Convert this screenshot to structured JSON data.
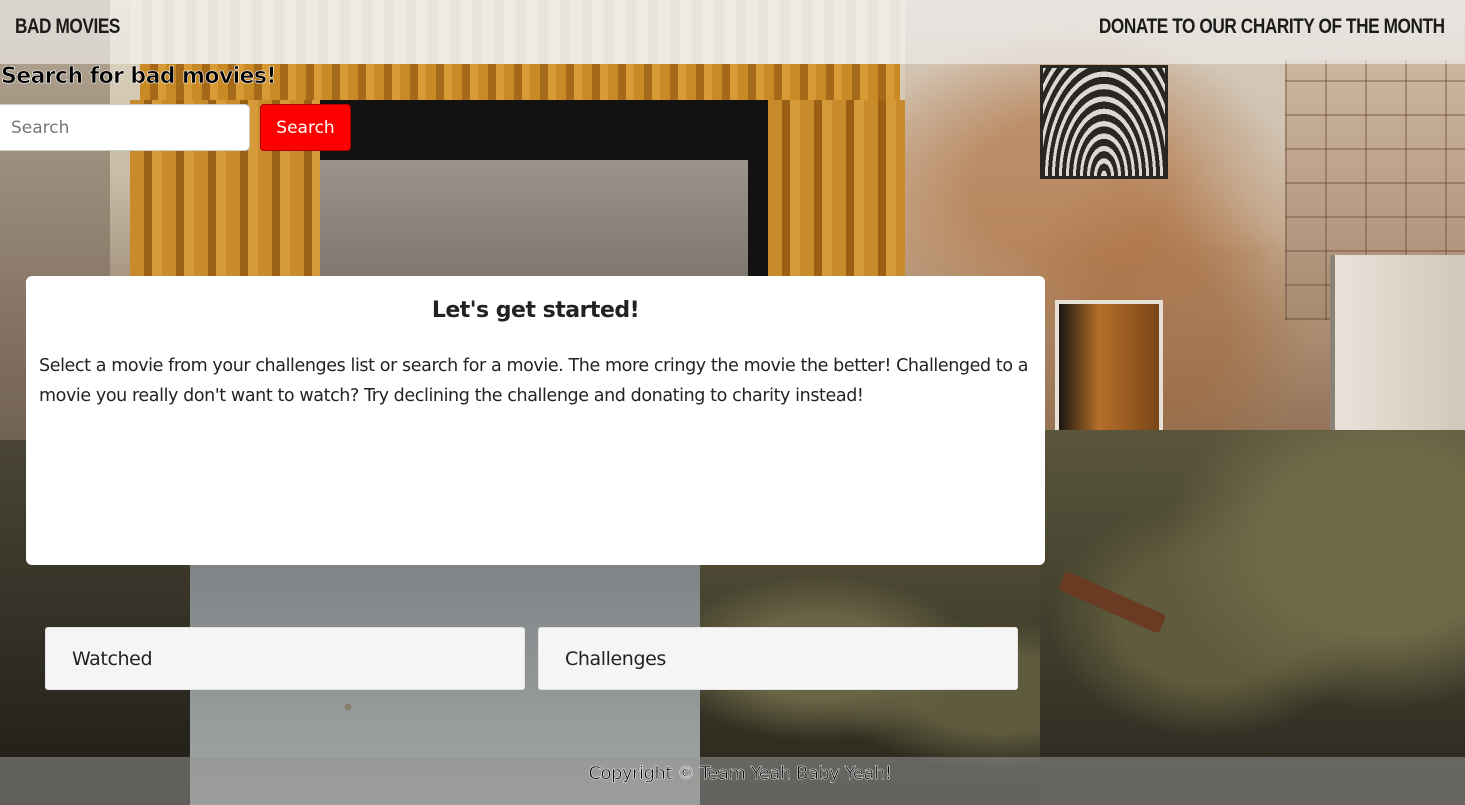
{
  "header": {
    "brand": "BAD MOVIES",
    "donate_link": "DONATE TO OUR CHARITY OF THE MONTH"
  },
  "search": {
    "heading": "Search for bad movies!",
    "placeholder": "Search",
    "button_label": "Search"
  },
  "card": {
    "title": "Let's get started!",
    "text": "Select a movie from your challenges list or search for a movie. The more cringy the movie the better! Challenged to a movie you really don't want to watch? Try declining the challenge and donating to charity instead!"
  },
  "lists": {
    "watched_label": "Watched",
    "challenges_label": "Challenges"
  },
  "footer": {
    "copyright": "Copyright © Team Yeah Baby Yeah!"
  },
  "colors": {
    "search_button": "#ff0000",
    "card_background": "#ffffff"
  }
}
